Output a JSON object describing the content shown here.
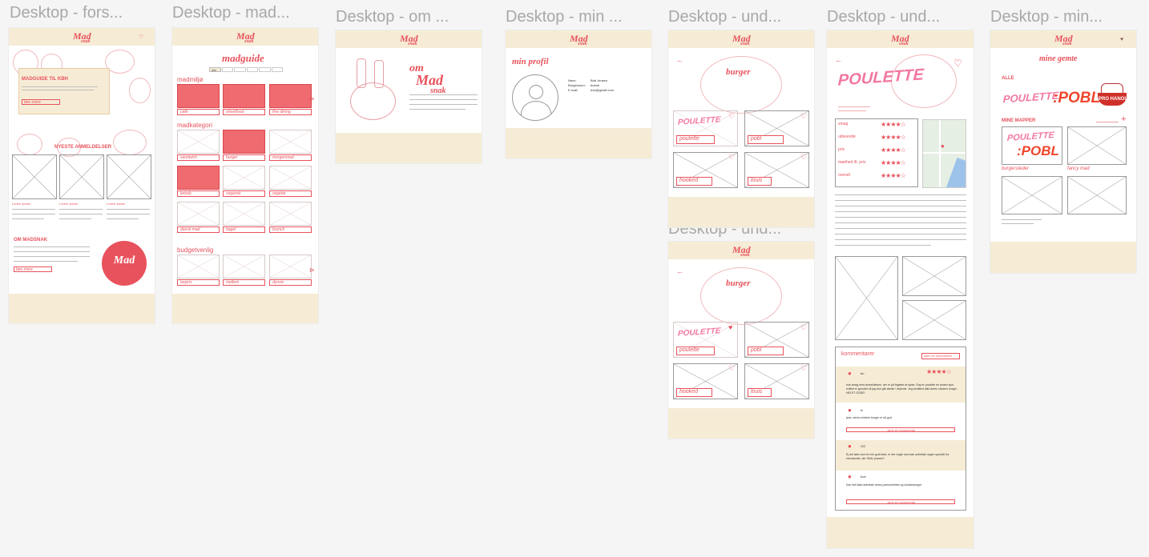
{
  "frames": [
    {
      "title": "Desktop - fors..."
    },
    {
      "title": "Desktop - mad..."
    },
    {
      "title": "Desktop - om ..."
    },
    {
      "title": "Desktop - min ..."
    },
    {
      "title": "Desktop - und..."
    },
    {
      "title": "Desktop - und..."
    },
    {
      "title": "Desktop - min..."
    },
    {
      "title": "Desktop - und..."
    }
  ],
  "logo": {
    "main": "Mad",
    "sub": "snak"
  },
  "forside": {
    "hero_title": "MADGUIDE TIL KBH",
    "hero_button": "læs mere",
    "reviews_heading": "NYESTE ANMELDELSER",
    "card_titles": [
      "Lorem Ipsum",
      "Lorem Ipsum",
      "Lorem Ipsum"
    ],
    "about_heading": "OM MADSNAK",
    "about_button": "læs mere"
  },
  "madguide": {
    "title": "madguide",
    "filters": [
      "alle",
      "",
      "",
      "",
      "",
      "",
      ""
    ],
    "madmiljo_heading": "madmiljø",
    "madmiljo": [
      "café",
      "streetfood",
      "fine dining"
    ],
    "madkategori_heading": "madkategori",
    "madkategori": [
      "sandwich",
      "burger",
      "morgenmad",
      "kebab",
      "vegansk",
      "vegetar",
      "dansk mad",
      "bagel",
      "brunch"
    ],
    "budget_heading": "budgetvenlig",
    "budget": [
      "lavpris",
      "mellem",
      "dyrere"
    ]
  },
  "om": {
    "title_top": "om",
    "title_mid": "Mad",
    "title_bot": "snak"
  },
  "profil": {
    "title": "min profil",
    "fields": [
      {
        "label": "Navn:",
        "value": "Bob Jensen"
      },
      {
        "label": "Brugernavn:",
        "value": "bobob"
      },
      {
        "label": "E-mail:",
        "value": "bob@gmail.com"
      }
    ]
  },
  "burger": {
    "title": "burger",
    "cards": [
      "poulette",
      "pobl",
      "hooked",
      "louis"
    ]
  },
  "restaurant": {
    "name": "POULETTE",
    "ratings": [
      {
        "label": "smag",
        "stars": "★★★★☆"
      },
      {
        "label": "udseende",
        "stars": "★★★★☆"
      },
      {
        "label": "pris",
        "stars": "★★★★☆"
      },
      {
        "label": "mæthed ift. pris",
        "stars": "★★★★☆"
      },
      {
        "label": "overall",
        "stars": "★★★★☆"
      }
    ],
    "comments_heading": "kommentarer",
    "comments_button": "skriv en kommentar",
    "comments": [
      {
        "user": "bo",
        "stars": "★★★★☆",
        "text": "bob ønsig med anmeldelsen, der er på bigeted at spise. Day er poulette en anden slyb, hvilket er grunden til jeg dun går steder i dejemie. Jeg bestilled altid deres chicken burger. HELST GODE!"
      },
      {
        "user": "tv",
        "stars": "",
        "text": "jane, deres chicken burger er så god"
      },
      {
        "user": "OO",
        "stars": "",
        "text": "Ej det føler som et rich godt sted, er der nogle som kan anbefale nogen specielt fra menukortet, der SKAL prøves?"
      },
      {
        "user": "bob",
        "stars": "",
        "text": "Kan helt klart anbefale deres pommesfrites og chickenburger"
      }
    ],
    "reply_button": "skriv en kommentar"
  },
  "mine_gemte": {
    "title": "mine gemte",
    "all_label": "ALLE",
    "folders_heading": "MINE MAPPER",
    "folders": [
      "burgersteder",
      "fancy mad",
      "",
      ""
    ],
    "logos": {
      "poulette": "POULETTE",
      "pobl": ":POBL",
      "prohanoi": "PRO HANOI"
    }
  }
}
